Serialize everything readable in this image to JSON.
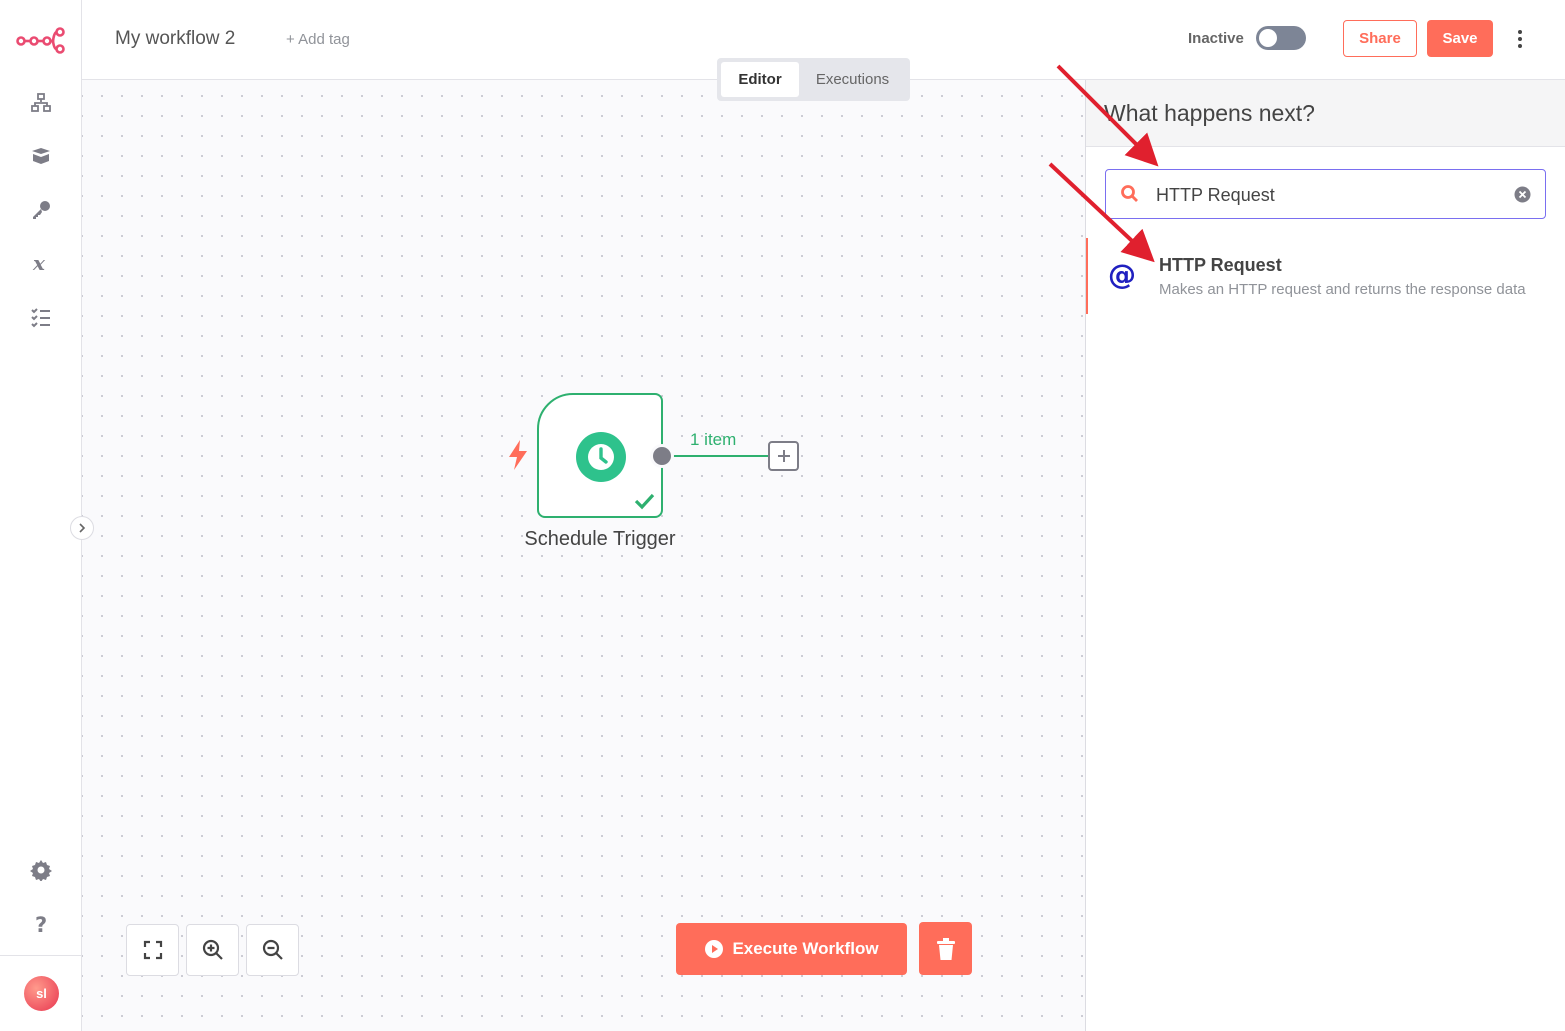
{
  "header": {
    "workflow_name": "My workflow 2",
    "add_tag": "+ Add tag",
    "status_label": "Inactive",
    "share_label": "Share",
    "save_label": "Save"
  },
  "tabs": {
    "editor": "Editor",
    "executions": "Executions"
  },
  "canvas": {
    "node_label": "Schedule Trigger",
    "connection_label": "1 item",
    "execute_label": "Execute Workflow"
  },
  "panel": {
    "title": "What happens next?",
    "search_value": "HTTP Request",
    "result": {
      "title": "HTTP Request",
      "description": "Makes an HTTP request and returns the response data",
      "icon": "@"
    }
  },
  "sidebar": {
    "avatar_initials": "sl"
  },
  "colors": {
    "brand": "#ff6d5a",
    "success": "#2eb06f",
    "node_icon": "#2ec28c",
    "annotation": "#e0202e"
  }
}
